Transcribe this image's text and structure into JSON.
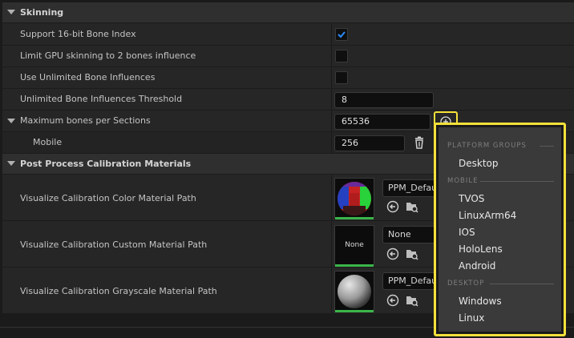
{
  "sections": {
    "skinning": "Skinning",
    "post_process": "Post Process Calibration Materials"
  },
  "skinning_rows": {
    "support_16bit": {
      "label": "Support 16-bit Bone Index",
      "checked": true
    },
    "limit_gpu": {
      "label": "Limit GPU skinning to 2 bones influence",
      "checked": false
    },
    "unlimited": {
      "label": "Use Unlimited Bone Influences",
      "checked": false
    },
    "threshold": {
      "label": "Unlimited Bone Influences Threshold",
      "value": "8"
    },
    "max_bones": {
      "label": "Maximum bones per Sections",
      "value": "65536"
    },
    "mobile": {
      "label": "Mobile",
      "value": "256"
    }
  },
  "materials": [
    {
      "label": "Visualize Calibration Color Material Path",
      "value": "PPM_Defau",
      "thumb": "color"
    },
    {
      "label": "Visualize Calibration Custom Material Path",
      "value": "None",
      "thumb_text": "None"
    },
    {
      "label": "Visualize Calibration Grayscale Material Path",
      "value": "PPM_Defau",
      "thumb": "grayscale"
    }
  ],
  "dropdown": {
    "platform_groups_header": "PLATFORM GROUPS",
    "platform_groups": [
      "Desktop"
    ],
    "mobile_header": "MOBILE",
    "mobile": [
      "TVOS",
      "LinuxArm64",
      "IOS",
      "HoloLens",
      "Android"
    ],
    "desktop_header": "DESKTOP",
    "desktop": [
      "Windows",
      "Linux"
    ]
  },
  "colors": {
    "highlight": "#f5e13a",
    "check": "#2a8cff",
    "thumb_bar": "#3bb54a"
  }
}
